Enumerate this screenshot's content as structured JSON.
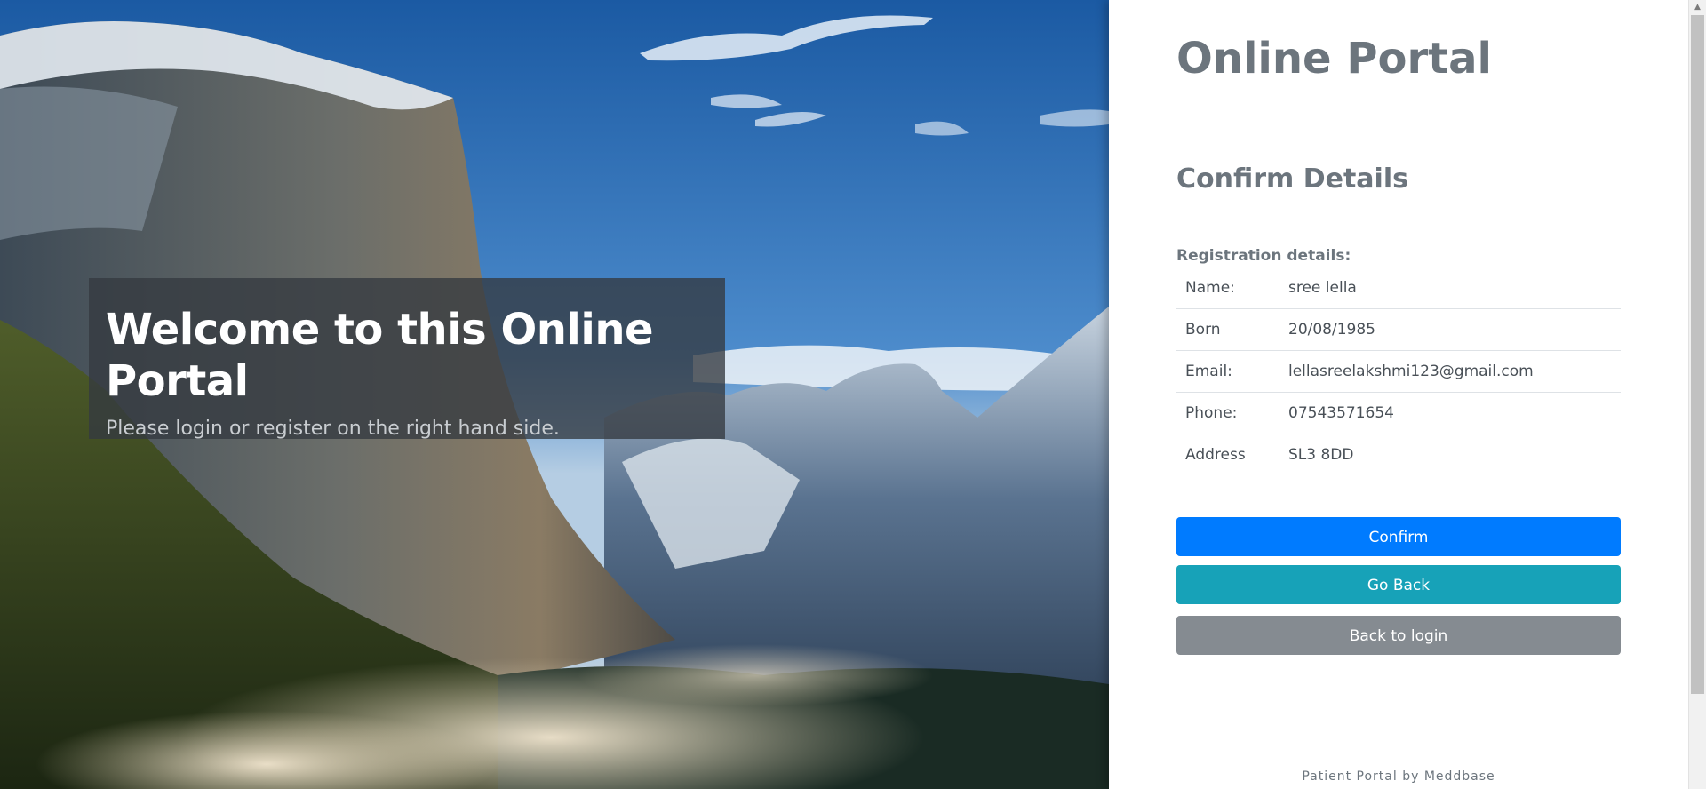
{
  "hero": {
    "title": "Welcome to this Online Portal",
    "subtitle": "Please login or register on the right hand side."
  },
  "panel": {
    "portal_title": "Online Portal",
    "confirm_title": "Confirm Details",
    "registration_label": "Registration details:",
    "details": [
      {
        "key": "Name:",
        "value": "sree lella"
      },
      {
        "key": "Born",
        "value": "20/08/1985"
      },
      {
        "key": "Email:",
        "value": "lellasreelakshmi123@gmail.com"
      },
      {
        "key": "Phone:",
        "value": "07543571654"
      },
      {
        "key": "Address",
        "value": "SL3 8DD"
      }
    ],
    "buttons": {
      "confirm": "Confirm",
      "go_back": "Go Back",
      "back_to_login": "Back to login"
    },
    "footer": "Patient Portal by Meddbase"
  },
  "colors": {
    "primary": "#007bff",
    "info": "#17a2b8",
    "secondary": "#858b91",
    "heading": "#6c757d"
  },
  "icons": {
    "scroll_up": "triangle-up"
  }
}
